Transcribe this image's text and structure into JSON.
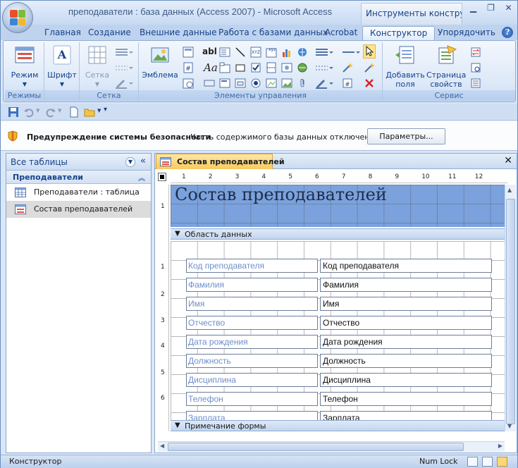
{
  "window": {
    "title": "преподаватели : база данных (Access 2007)  -  Microsoft Access",
    "context_tab": "Инструменты конструк..."
  },
  "tabs": [
    "Главная",
    "Создание",
    "Внешние данные",
    "Работа с базами данных",
    "Acrobat",
    "Конструктор",
    "Упорядочить"
  ],
  "active_tab": "Конструктор",
  "ribbon": {
    "groups": {
      "views": {
        "label": "Режимы",
        "button": "Режим"
      },
      "font": {
        "label": "",
        "button": "Шрифт"
      },
      "grid": {
        "label": "Сетка",
        "button": "Сетка"
      },
      "controls": {
        "label": "Элементы управления",
        "button": "Эмблема"
      },
      "tools": {
        "label": "Сервис",
        "add_fields_1": "Добавить",
        "add_fields_2": "поля",
        "props_1": "Страница",
        "props_2": "свойств"
      }
    }
  },
  "security": {
    "title": "Предупреждение системы безопасности",
    "message": "Часть содержимого базы данных отключено",
    "button": "Параметры..."
  },
  "nav": {
    "header": "Все таблицы",
    "group": "Преподаватели",
    "items": [
      {
        "label": "Преподаватели : таблица",
        "type": "table"
      },
      {
        "label": "Состав преподавателей",
        "type": "form"
      }
    ]
  },
  "document": {
    "tab_label": "Состав преподавателей",
    "form_title": "Состав преподавателей",
    "sections": {
      "detail": "Область данных",
      "footer": "Примечание формы"
    },
    "fields": [
      {
        "label": "Код преподавателя",
        "control": "Код преподавателя"
      },
      {
        "label": "Фамилия",
        "control": "Фамилия"
      },
      {
        "label": "Имя",
        "control": "Имя"
      },
      {
        "label": "Отчество",
        "control": "Отчество"
      },
      {
        "label": "Дата рождения",
        "control": "Дата рождения"
      },
      {
        "label": "Должность",
        "control": "Должность"
      },
      {
        "label": "Дисциплина",
        "control": "Дисциплина"
      },
      {
        "label": "Телефон",
        "control": "Телефон"
      },
      {
        "label": "Зарплата",
        "control": "Зарплата"
      }
    ],
    "ruler_h": [
      "1",
      "2",
      "3",
      "4",
      "5",
      "6",
      "7",
      "8",
      "9",
      "10",
      "11",
      "12"
    ],
    "ruler_v": [
      "1",
      "1",
      "2",
      "3",
      "4",
      "5",
      "6"
    ]
  },
  "status": {
    "mode": "Конструктор",
    "numlock": "Num Lock"
  },
  "colors": {
    "header_fill": "#7ba2dd",
    "field_label_text": "#6f8fc9",
    "tab_active": "#f8c95e"
  }
}
